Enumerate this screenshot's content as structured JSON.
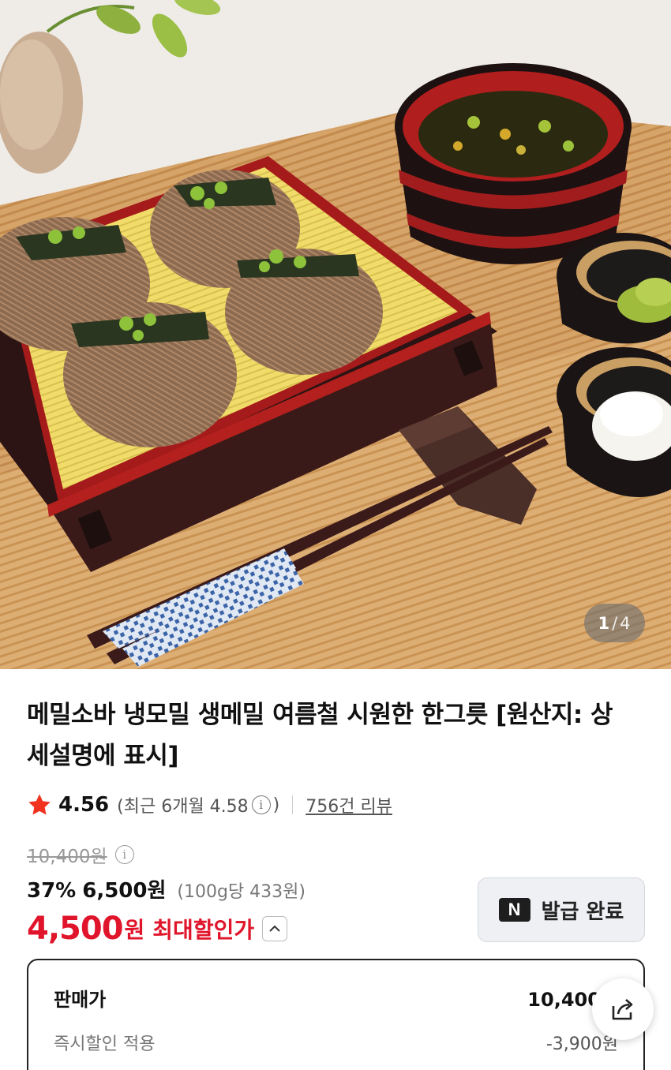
{
  "image": {
    "current": "1",
    "separator": "/",
    "total": "4"
  },
  "product": {
    "title": "메밀소바 냉모밀 생메밀 여름철 시원한 한그릇 [원산지: 상세설명에 표시]"
  },
  "rating": {
    "value": "4.56",
    "recent_prefix": "(최근 6개월 4.58",
    "recent_suffix": ")",
    "reviews": "756건 리뷰",
    "info_glyph": "i"
  },
  "price": {
    "original": "10,400원",
    "discount": "37%",
    "sale": "6,500원",
    "unit": "(100g당 433원)",
    "max_amount": "4,500",
    "max_won": "원",
    "max_label": "최대할인가"
  },
  "coupon": {
    "icon": "N",
    "label": "발급 완료"
  },
  "breakdown": {
    "row1_label": "판매가",
    "row1_value": "10,400원",
    "row2_label": "즉시할인 적용",
    "row2_value": "-3,900원"
  },
  "colors": {
    "accent_red": "#e0142a",
    "text": "#111111",
    "muted": "#777777"
  },
  "icons": {
    "star": "star-icon",
    "info": "info-icon",
    "chevron": "chevron-up-icon",
    "share": "share-icon",
    "naver": "naver-n-icon"
  }
}
